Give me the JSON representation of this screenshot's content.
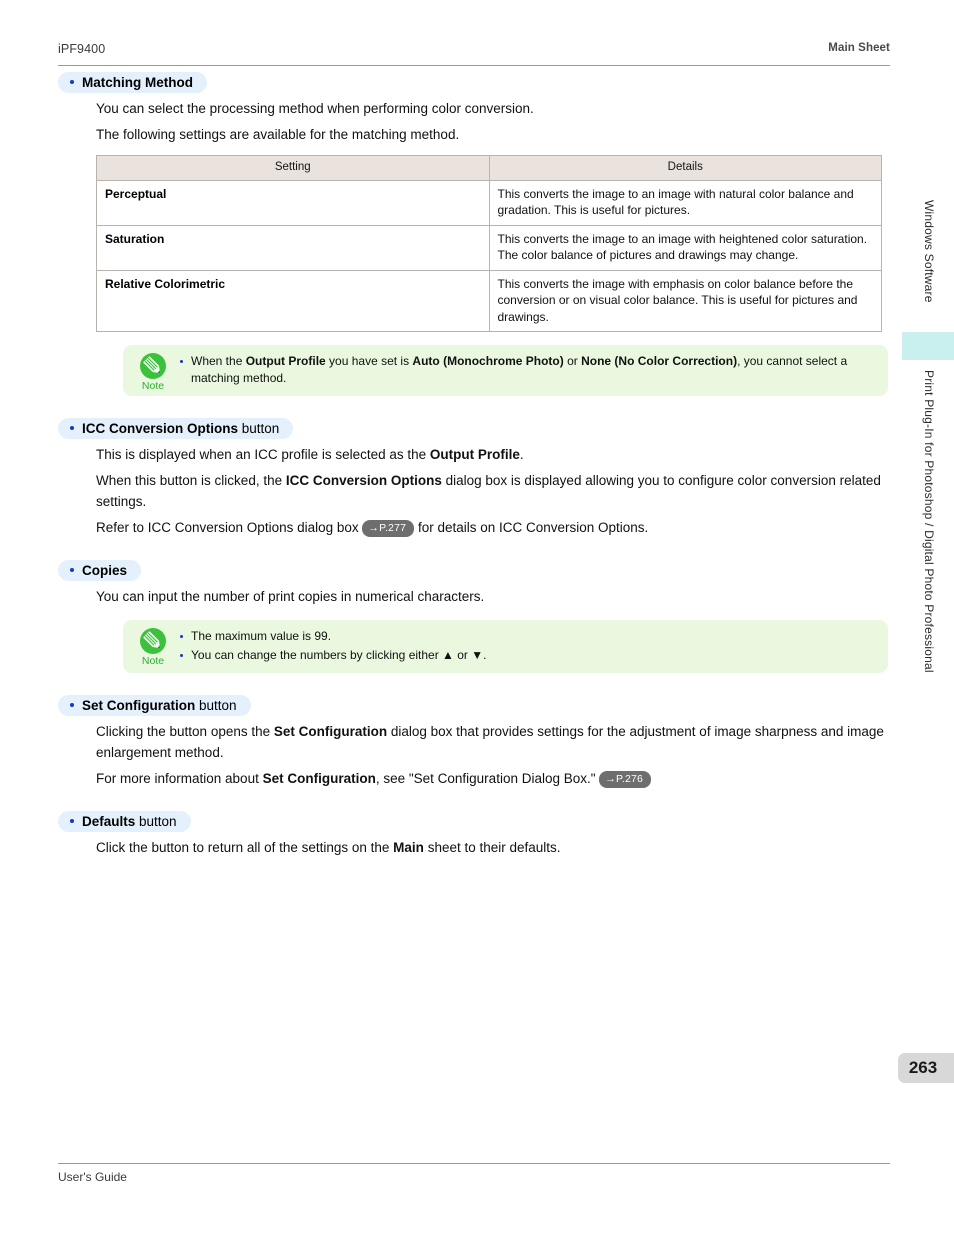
{
  "header": {
    "model": "iPF9400",
    "sheet": "Main Sheet"
  },
  "footer": {
    "guide": "User's Guide"
  },
  "sidebar": {
    "label_top": "Windows Software",
    "label_main": "Print Plug-In for Photoshop / Digital Photo Professional",
    "tab_color": "#c9f0ee"
  },
  "page_number": "263",
  "sections": [
    {
      "id": "matching-method",
      "heading_strong": "Matching Method",
      "heading_plain": "",
      "paragraphs": [
        "You can select the processing method when performing color conversion.",
        "The following settings are available for the matching method."
      ]
    },
    {
      "id": "icc-conversion-options",
      "heading_strong": "ICC Conversion Options",
      "heading_plain": " button"
    },
    {
      "id": "copies",
      "heading_strong": "Copies",
      "heading_plain": "",
      "paragraphs": [
        "You can input the number of print copies in numerical characters."
      ]
    },
    {
      "id": "set-configuration",
      "heading_strong": "Set Configuration",
      "heading_plain": " button"
    },
    {
      "id": "defaults",
      "heading_strong": "Defaults",
      "heading_plain": " button"
    }
  ],
  "table": {
    "headers": [
      "Setting",
      "Details"
    ],
    "rows": [
      {
        "setting": "Perceptual",
        "details": "This converts the image to an image with natural color balance and gradation. This is useful for pictures."
      },
      {
        "setting": "Saturation",
        "details": "This converts the image to an image with heightened color saturation. The color balance of pictures and drawings may change."
      },
      {
        "setting": "Relative Colorimetric",
        "details": "This converts the image with emphasis on color balance before the conversion or on visual color balance. This is useful for pictures and drawings."
      }
    ]
  },
  "note1": {
    "icon_label": "Note",
    "t1": "When the ",
    "b1": "Output Profile",
    "t2": " you have set is ",
    "b2": "Auto (Monochrome Photo)",
    "t3": " or ",
    "b3": "None (No Color Correction)",
    "t4": ", you cannot select a matching method."
  },
  "note2": {
    "icon_label": "Note",
    "item1": "The maximum value is 99.",
    "item2": "You can change the numbers by clicking either ▲ or ▼."
  },
  "icc_section": {
    "p1_t1": "This is displayed when an ICC profile is selected as the ",
    "p1_b1": "Output Profile",
    "p1_t2": ".",
    "p2_t1": "When this button is clicked, the ",
    "p2_b1": "ICC Conversion Options",
    "p2_t2": " dialog box is displayed allowing you to configure color conversion related settings.",
    "p3_t1": "Refer to ICC Conversion Options dialog box ",
    "p3_ref": "→P.277",
    "p3_t2": " for details on ICC Conversion Options."
  },
  "setconf_section": {
    "p1_t1": "Clicking the button opens the ",
    "p1_b1": "Set Configuration",
    "p1_t2": " dialog box that provides settings for the adjustment of image sharpness and image enlargement method.",
    "p2_t1": "For more information about ",
    "p2_b1": "Set Configuration",
    "p2_t2": ", see \"Set Configuration Dialog Box.\" ",
    "p2_ref": "→P.276"
  },
  "defaults_section": {
    "p1_t1": "Click the button to return all of the settings on the ",
    "p1_b1": "Main",
    "p1_t2": " sheet to their defaults."
  }
}
